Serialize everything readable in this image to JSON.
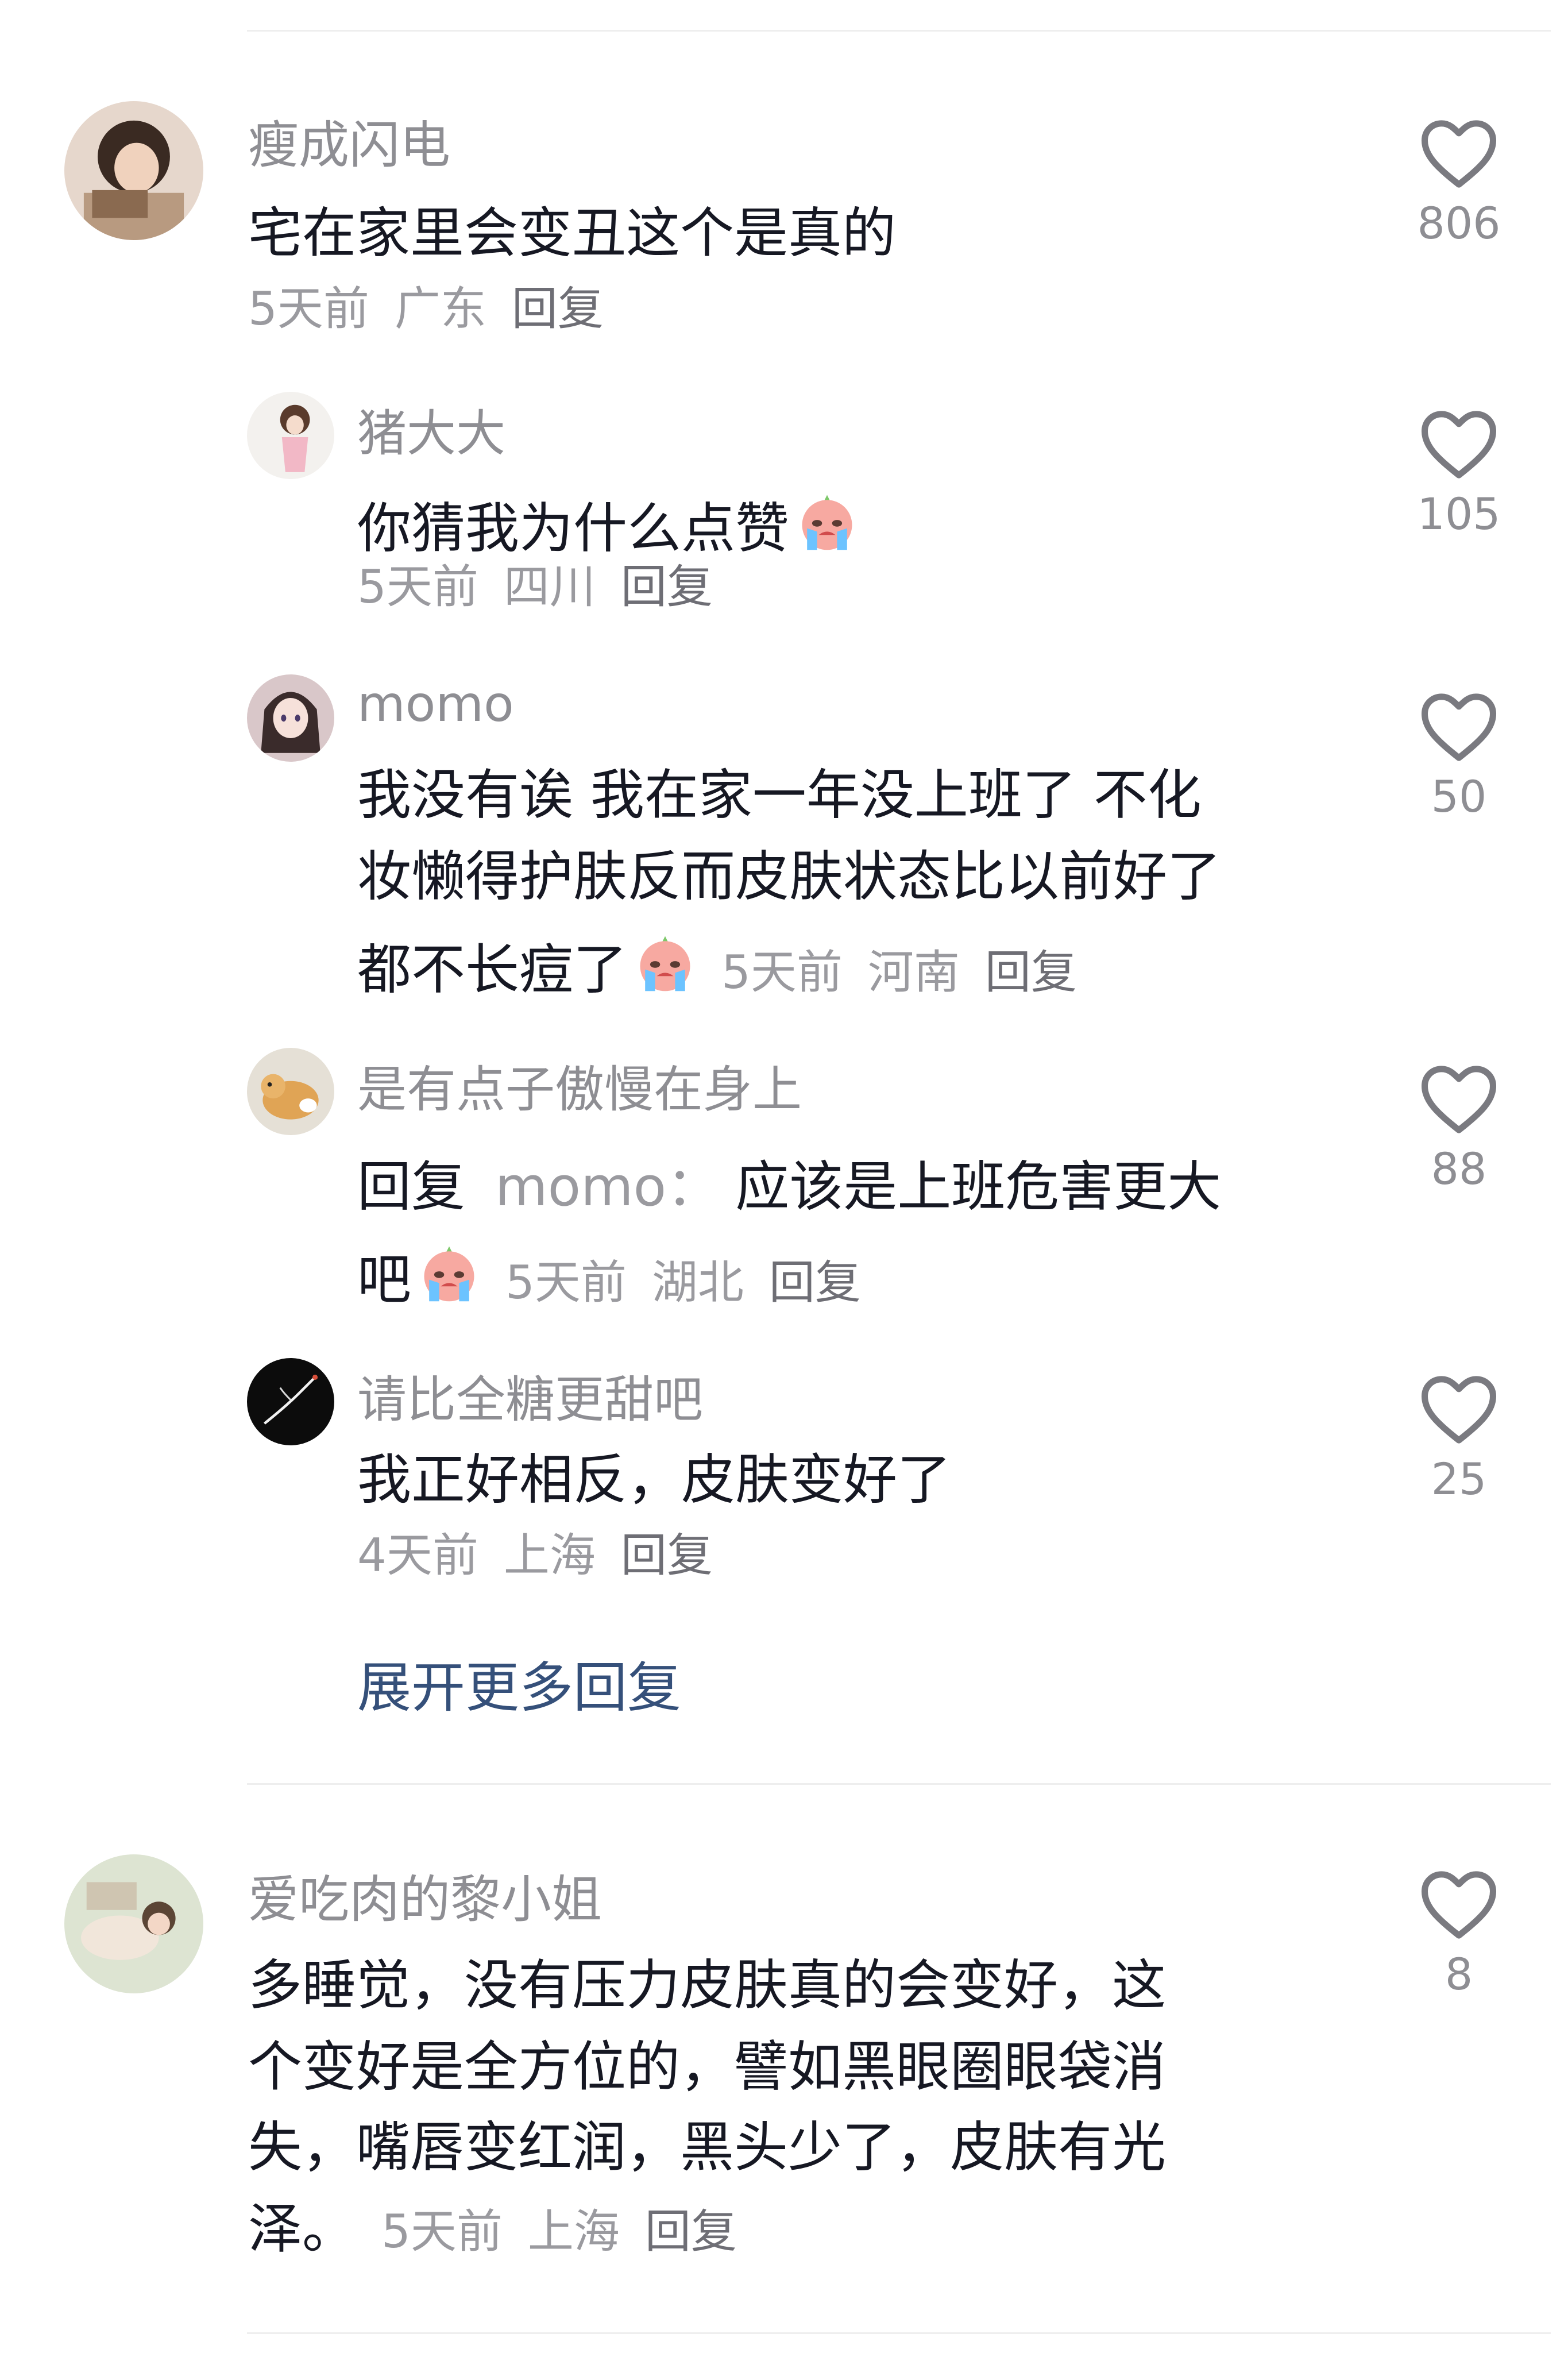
{
  "comments": [
    {
      "username": "瘦成闪电",
      "text": "宅在家里会变丑这个是真的",
      "time": "5天前",
      "location": "广东",
      "reply_label": "回复",
      "likes": "806",
      "replies": [
        {
          "username": "猪大大",
          "text": "你猜我为什么点赞",
          "time": "5天前",
          "location": "四川",
          "reply_label": "回复",
          "likes": "105"
        },
        {
          "username": "momo",
          "text_lines": [
            "我没有诶  我在家一年没上班了  不化",
            "妆懒得护肤反而皮肤状态比以前好了",
            "都不长痘了"
          ],
          "time": "5天前",
          "location": "河南",
          "reply_label": "回复",
          "likes": "50"
        },
        {
          "username": "是有点子傲慢在身上",
          "reply_prefix": "回复",
          "reply_to": "momo：",
          "text_lines": [
            "应该是上班危害更大",
            "吧"
          ],
          "time": "5天前",
          "location": "湖北",
          "reply_label": "回复",
          "likes": "88"
        },
        {
          "username": "请比全糖更甜吧",
          "text": "我正好相反，皮肤变好了",
          "time": "4天前",
          "location": "上海",
          "reply_label": "回复",
          "likes": "25"
        }
      ],
      "expand_label": "展开更多回复"
    },
    {
      "username": "爱吃肉的黎小姐",
      "text_lines": [
        "多睡觉，没有压力皮肤真的会变好，这",
        "个变好是全方位的，譬如黑眼圈眼袋消",
        "失，嘴唇变红润，黑头少了，皮肤有光",
        "泽。"
      ],
      "time": "5天前",
      "location": "上海",
      "reply_label": "回复",
      "likes": "8"
    }
  ],
  "icons": {
    "like": "heart-outline-icon",
    "emoji": "crying-face-emoji-icon"
  },
  "colors": {
    "text": "#161823",
    "secondary": "#8e8e93",
    "link": "#35507a",
    "divider": "#eeeeee"
  }
}
